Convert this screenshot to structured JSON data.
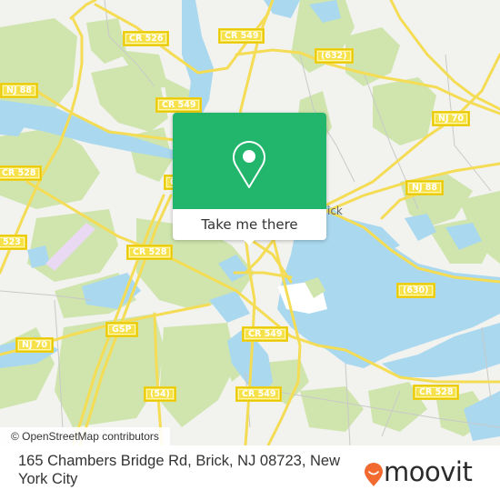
{
  "map": {
    "colors": {
      "land": "#f2f2ef",
      "park": "#cfe5ad",
      "water": "#a9d8ef",
      "road_major": "#f5dc55",
      "road_minor": "#c9c9c9",
      "airport": "#e9d9f2"
    },
    "road_labels": [
      {
        "id": "cr526",
        "text": "CR 526"
      },
      {
        "id": "cr549-top",
        "text": "CR 549"
      },
      {
        "id": "cr632",
        "text": "(632)"
      },
      {
        "id": "nj88-west",
        "text": "NJ 88"
      },
      {
        "id": "cr549-north",
        "text": "CR 549"
      },
      {
        "id": "nj70-east",
        "text": "NJ 70"
      },
      {
        "id": "cr528-west",
        "text": "CR 528"
      },
      {
        "id": "nj88-east",
        "text": "NJ 88"
      },
      {
        "id": "cr523",
        "text": "523"
      },
      {
        "id": "cr528-mid",
        "text": "CR 528"
      },
      {
        "id": "cr630",
        "text": "(630)"
      },
      {
        "id": "gsp",
        "text": "GSP"
      },
      {
        "id": "cr549-mid",
        "text": "CR 549"
      },
      {
        "id": "nj70-west",
        "text": "NJ 70"
      },
      {
        "id": "cr54",
        "text": "(54)"
      },
      {
        "id": "cr549-south",
        "text": "CR 549"
      },
      {
        "id": "cr528-east",
        "text": "CR 528"
      },
      {
        "id": "partial-c",
        "text": "C"
      }
    ],
    "place_labels": [
      {
        "id": "brick",
        "text": "ick"
      }
    ],
    "attribution": "© OpenStreetMap contributors"
  },
  "popup": {
    "icon": "map-pin-icon",
    "button_label": "Take me there",
    "color": "#21b66b"
  },
  "footer": {
    "address": "165 Chambers Bridge Rd, Brick, NJ 08723, New York City",
    "brand": "moovit",
    "brand_icon": "moovit-pin-smile-icon",
    "brand_color": "#f26a30"
  }
}
